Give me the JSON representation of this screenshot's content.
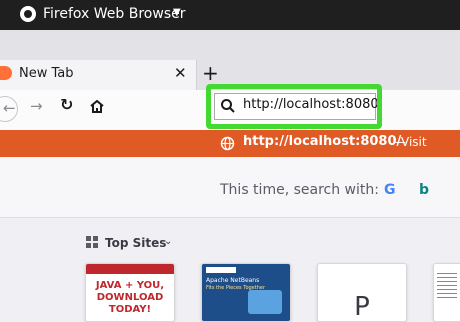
{
  "window": {
    "app_title": "Firefox Web Browser",
    "tab_label": "New Tab"
  },
  "toolbar": {
    "url_value": "http://localhost:8080"
  },
  "suggestion": {
    "url": "http://localhost:8080/",
    "separator": "—",
    "action": "Visit"
  },
  "search": {
    "prompt": "This time, search with:"
  },
  "top_sites": {
    "label": "Top Sites",
    "tiles": [
      {
        "text_lines": [
          "JAVA + YOU,",
          "DOWNLOAD",
          "TODAY!"
        ]
      },
      {
        "text_lines": [
          "Apache NetBeans",
          "Fits the Pieces Together"
        ]
      },
      {
        "letter": "P"
      }
    ]
  },
  "colors": {
    "highlight": "#43d832",
    "suggestion_bar": "#df5a24",
    "topbar": "#1f1f1f"
  }
}
